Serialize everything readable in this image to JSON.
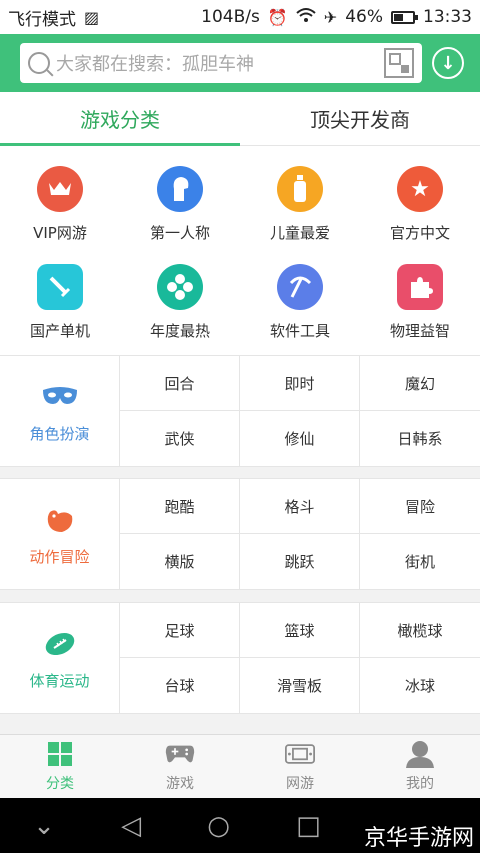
{
  "status_bar": {
    "mode": "飞行模式",
    "speed": "104B/s",
    "battery_percent": "46%",
    "time": "13:33"
  },
  "search": {
    "placeholder": "大家都在搜索：孤胆车神"
  },
  "tabs": [
    {
      "label": "游戏分类",
      "active": true
    },
    {
      "label": "顶尖开发商",
      "active": false
    }
  ],
  "categories_grid": [
    {
      "label": "VIP网游",
      "icon": "crown-icon",
      "color": "#ea5a43"
    },
    {
      "label": "第一人称",
      "icon": "head-icon",
      "color": "#3b82e8"
    },
    {
      "label": "儿童最爱",
      "icon": "bottle-icon",
      "color": "#f6a623"
    },
    {
      "label": "官方中文",
      "icon": "star-icon",
      "color": "#ee5b3a"
    },
    {
      "label": "国产单机",
      "icon": "sword-icon",
      "color": "#27c6d8"
    },
    {
      "label": "年度最热",
      "icon": "flower-icon",
      "color": "#19b99a"
    },
    {
      "label": "软件工具",
      "icon": "pickaxe-icon",
      "color": "#5b7ee8"
    },
    {
      "label": "物理益智",
      "icon": "puzzle-icon",
      "color": "#e94e6a"
    }
  ],
  "sections": [
    {
      "title": "角色扮演",
      "color": "#4a8ed8",
      "icon": "mask-icon",
      "items": [
        "回合",
        "即时",
        "魔幻",
        "武侠",
        "修仙",
        "日韩系"
      ]
    },
    {
      "title": "动作冒险",
      "color": "#ee6b3d",
      "icon": "dinosaur-icon",
      "items": [
        "跑酷",
        "格斗",
        "冒险",
        "横版",
        "跳跃",
        "街机"
      ]
    },
    {
      "title": "体育运动",
      "color": "#2bb78a",
      "icon": "football-icon",
      "items": [
        "足球",
        "篮球",
        "橄榄球",
        "台球",
        "滑雪板",
        "冰球"
      ]
    }
  ],
  "bottom_nav": [
    {
      "label": "分类",
      "icon": "grid-icon",
      "active": true
    },
    {
      "label": "游戏",
      "icon": "gamepad-icon",
      "active": false
    },
    {
      "label": "网游",
      "icon": "handheld-icon",
      "active": false
    },
    {
      "label": "我的",
      "icon": "user-icon",
      "active": false
    }
  ],
  "watermark": "京华手游网",
  "colors": {
    "accent": "#3fc17b"
  }
}
